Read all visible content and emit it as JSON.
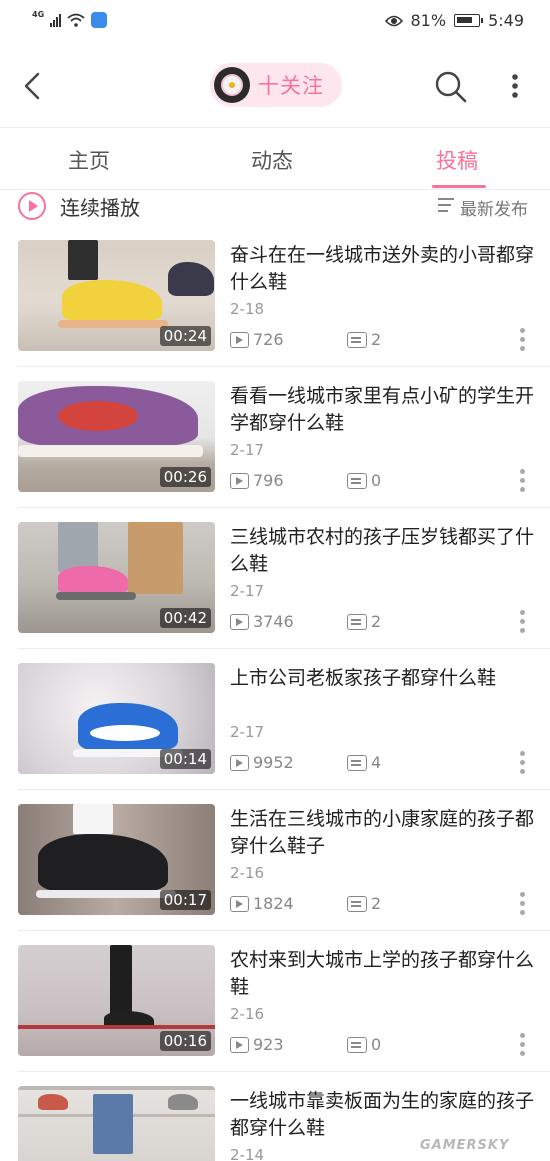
{
  "status_bar": {
    "network": "4G",
    "battery": "81%",
    "battery_level": 0.81,
    "time": "5:49"
  },
  "header": {
    "follow_label": "十关注"
  },
  "tabs": [
    {
      "label": "主页",
      "active": false
    },
    {
      "label": "动态",
      "active": false
    },
    {
      "label": "投稿",
      "active": true
    }
  ],
  "toolbar": {
    "continuous_play": "连续播放",
    "sort_label": "最新发布"
  },
  "videos": [
    {
      "title": "奋斗在在一线城市送外卖的小哥都穿什么鞋",
      "date": "2-18",
      "duration": "00:24",
      "plays": "726",
      "comments": "2"
    },
    {
      "title": "看看一线城市家里有点小矿的学生开学都穿什么鞋",
      "date": "2-17",
      "duration": "00:26",
      "plays": "796",
      "comments": "0"
    },
    {
      "title": "三线城市农村的孩子压岁钱都买了什么鞋",
      "date": "2-17",
      "duration": "00:42",
      "plays": "3746",
      "comments": "2"
    },
    {
      "title": "上市公司老板家孩子都穿什么鞋",
      "date": "2-17",
      "duration": "00:14",
      "plays": "9952",
      "comments": "4"
    },
    {
      "title": "生活在三线城市的小康家庭的孩子都穿什么鞋子",
      "date": "2-16",
      "duration": "00:17",
      "plays": "1824",
      "comments": "2"
    },
    {
      "title": "农村来到大城市上学的孩子都穿什么鞋",
      "date": "2-16",
      "duration": "00:16",
      "plays": "923",
      "comments": "0"
    },
    {
      "title": "一线城市靠卖板面为生的家庭的孩子都穿什么鞋",
      "date": "2-14",
      "duration": "",
      "plays": "",
      "comments": ""
    }
  ],
  "watermark": "GAMERSKY",
  "colors": {
    "accent": "#fb7299",
    "follow_bg": "#fde6ee",
    "meta": "#888888"
  }
}
